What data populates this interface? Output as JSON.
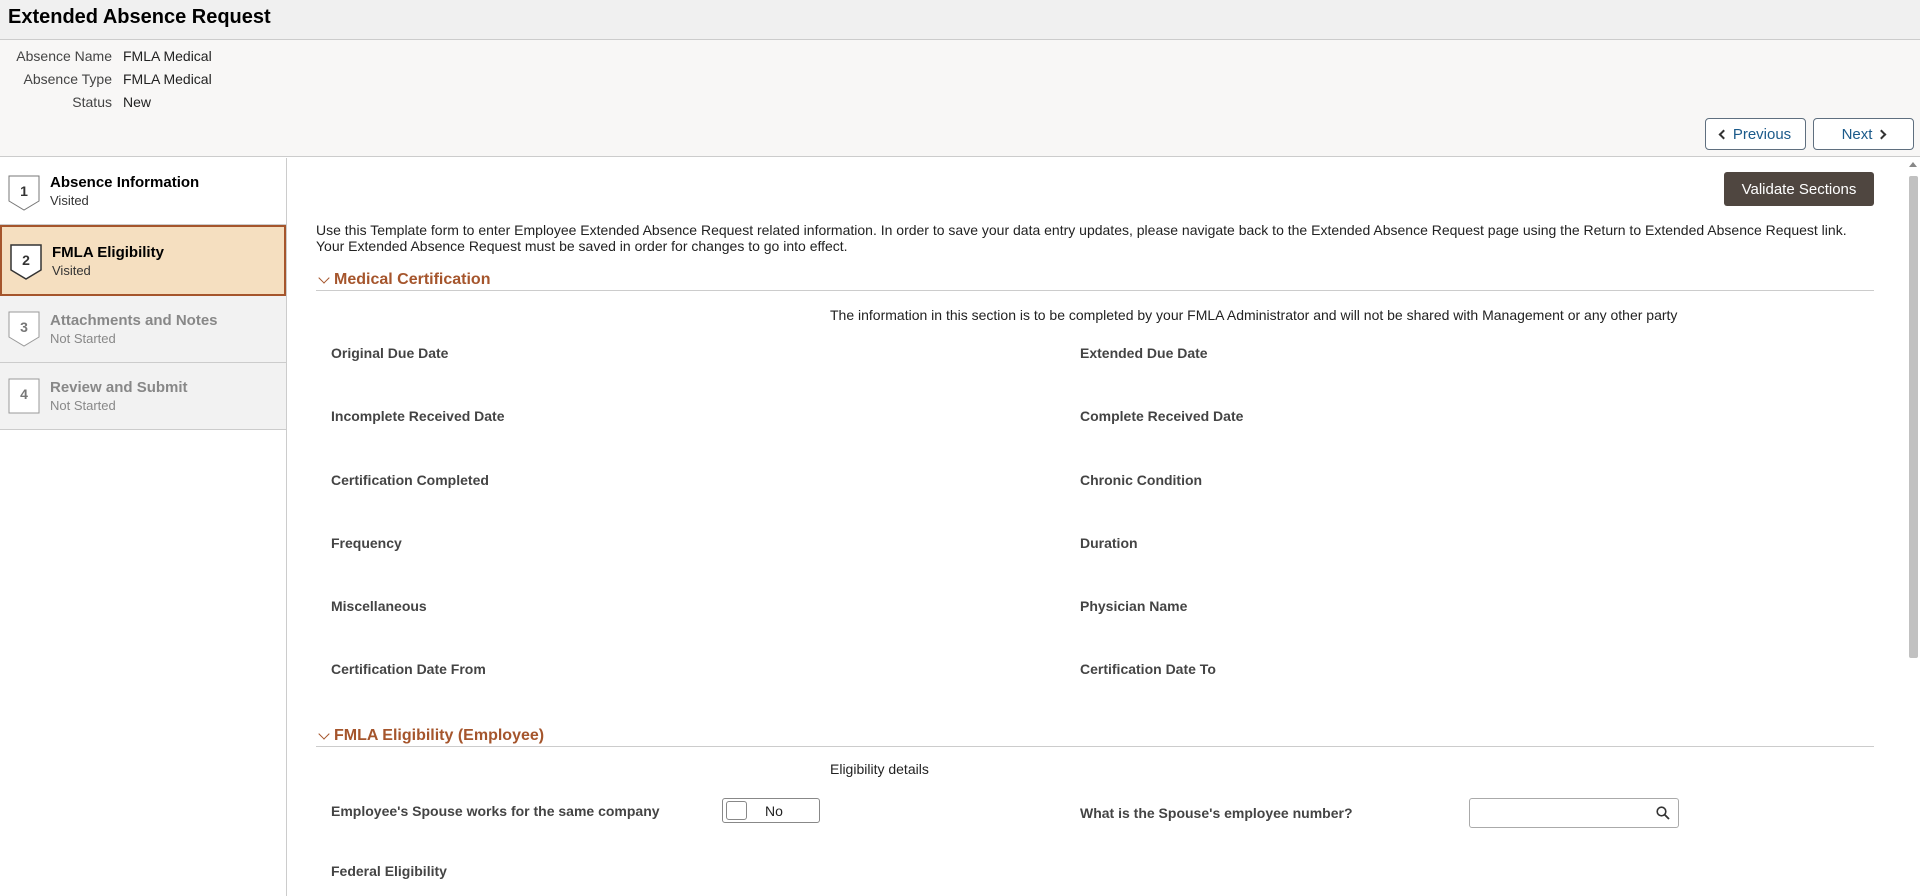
{
  "header": {
    "title": "Extended Absence Request"
  },
  "summary": {
    "absence_name_label": "Absence Name",
    "absence_name_value": "FMLA Medical",
    "absence_type_label": "Absence Type",
    "absence_type_value": "FMLA Medical",
    "status_label": "Status",
    "status_value": "New"
  },
  "nav": {
    "previous_label": "Previous",
    "next_label": "Next"
  },
  "steps": [
    {
      "num": "1",
      "title": "Absence Information",
      "status": "Visited"
    },
    {
      "num": "2",
      "title": "FMLA Eligibility",
      "status": "Visited"
    },
    {
      "num": "3",
      "title": "Attachments and Notes",
      "status": "Not Started"
    },
    {
      "num": "4",
      "title": "Review and Submit",
      "status": "Not Started"
    }
  ],
  "main": {
    "validate_label": "Validate Sections",
    "intro": "Use this Template form to enter Employee Extended Absence Request related information. In order to save your data entry updates, please navigate back to the Extended Absence Request page using the Return to Extended Absence Request link.  Your Extended Absence Request must be saved in order for changes to go into effect.",
    "medical": {
      "title": "Medical Certification",
      "note": "The information in this section is to be completed by your FMLA Administrator and will not be shared with Management or any other party",
      "fields": [
        "Original Due Date",
        "Extended Due Date",
        "Incomplete Received Date",
        "Complete Received Date",
        "Certification Completed",
        "Chronic Condition",
        "Frequency",
        "Duration",
        "Miscellaneous",
        "Physician Name",
        "Certification Date From",
        "Certification Date To"
      ]
    },
    "eligibility": {
      "title": "FMLA Eligibility (Employee)",
      "note": "Eligibility details",
      "spouse_label": "Employee's Spouse works for the same company",
      "spouse_toggle": "No",
      "spouse_number_label": "What is the Spouse's employee number?",
      "spouse_number_value": "",
      "federal_label": "Federal Eligibility"
    }
  },
  "colors": {
    "accent": "#a5552c",
    "active_step_bg": "#f5dfc0",
    "validate_bg": "#4f4640",
    "link": "#1b5a8a"
  }
}
